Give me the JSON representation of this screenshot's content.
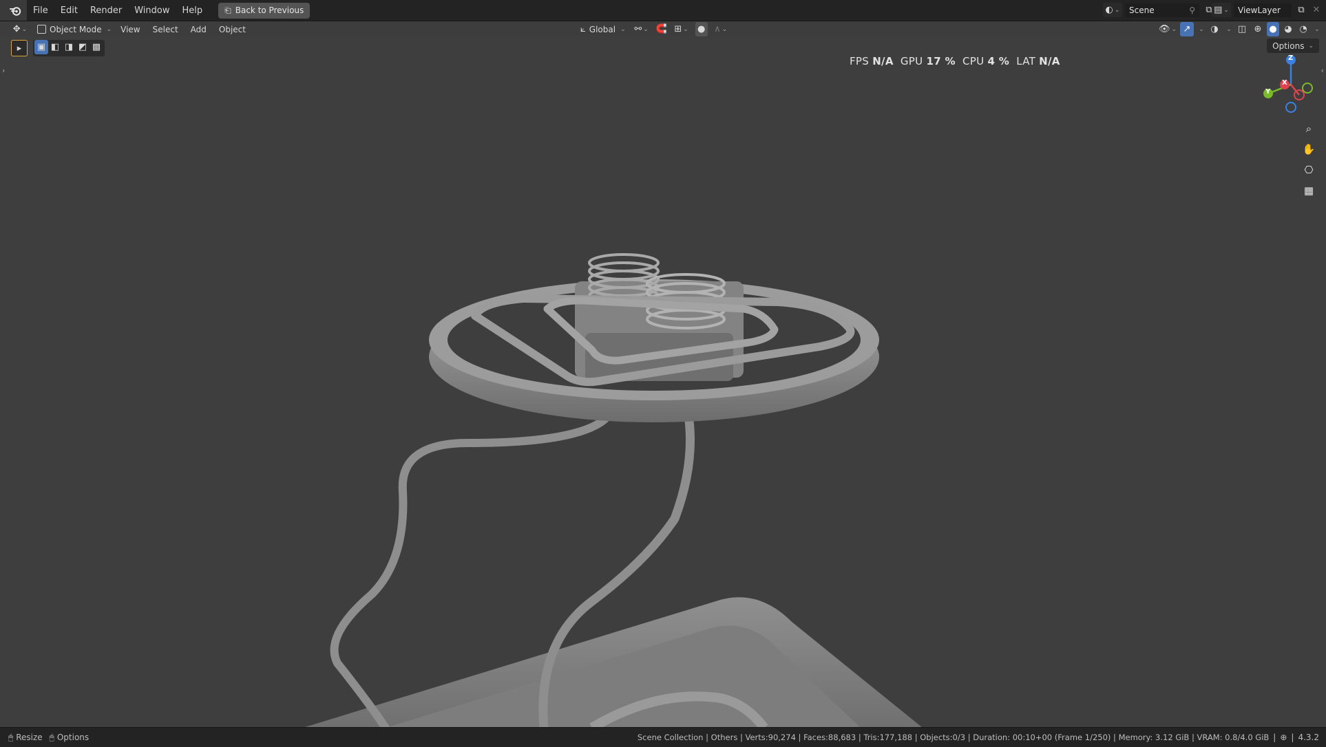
{
  "topbar": {
    "menu": [
      "File",
      "Edit",
      "Render",
      "Window",
      "Help"
    ],
    "back_label": "Back to Previous",
    "scene_label": "Scene",
    "viewlayer_label": "ViewLayer"
  },
  "header": {
    "mode_label": "Object Mode",
    "menus": [
      "View",
      "Select",
      "Add",
      "Object"
    ],
    "transform_orientation": "Global",
    "options_label": "Options"
  },
  "hud": {
    "fps_label": "FPS",
    "fps_value": "N/A",
    "gpu_label": "GPU",
    "gpu_value": "17 %",
    "cpu_label": "CPU",
    "cpu_value": "4 %",
    "lat_label": "LAT",
    "lat_value": "N/A"
  },
  "gizmo": {
    "z": "Z",
    "y": "Y",
    "x": "X"
  },
  "statusbar": {
    "resize_label": "Resize",
    "options_label": "Options",
    "stats": "Scene Collection | Others | Verts:90,274 | Faces:88,683 | Tris:177,188 | Objects:0/3 | Duration: 00:10+00 (Frame 1/250) | Memory: 3.12 GiB | VRAM: 0.8/4.0 GiB",
    "version": "4.3.2"
  },
  "colors": {
    "viewport_bg": "#3e3e3e",
    "axis_x": "#e0424e",
    "axis_y": "#7bbb2a",
    "axis_z": "#3b82e0",
    "active_blue": "#4772b3"
  }
}
